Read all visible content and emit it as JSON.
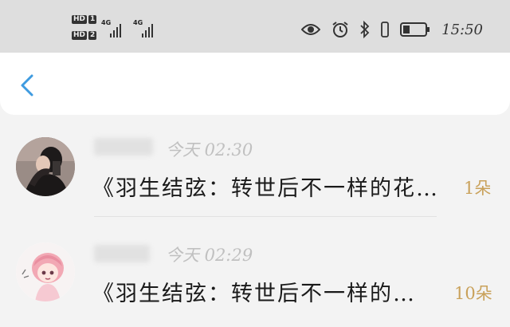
{
  "status_bar": {
    "sim1_label": "HD",
    "sim1_slot": "1",
    "sim2_label": "HD",
    "sim2_slot": "2",
    "network1": "4G",
    "network2": "4G",
    "time": "15:50",
    "icons": [
      "eye-icon",
      "alarm-icon",
      "bluetooth-icon",
      "vibrate-icon",
      "battery-icon"
    ]
  },
  "header": {
    "back_icon": "chevron-left-icon",
    "accent_color": "#3f9be0"
  },
  "messages": [
    {
      "time": "今天 02:30",
      "text": "《羽生结弦：转世后不一样的花…",
      "count": "1朵"
    },
    {
      "time": "今天 02:29",
      "text": "《羽生结弦：转世后不一样的…",
      "count": "10朵"
    }
  ],
  "colors": {
    "status_bar_bg": "#dedede",
    "time_text": "#c0c0c0",
    "count_text": "#c9a15a"
  }
}
